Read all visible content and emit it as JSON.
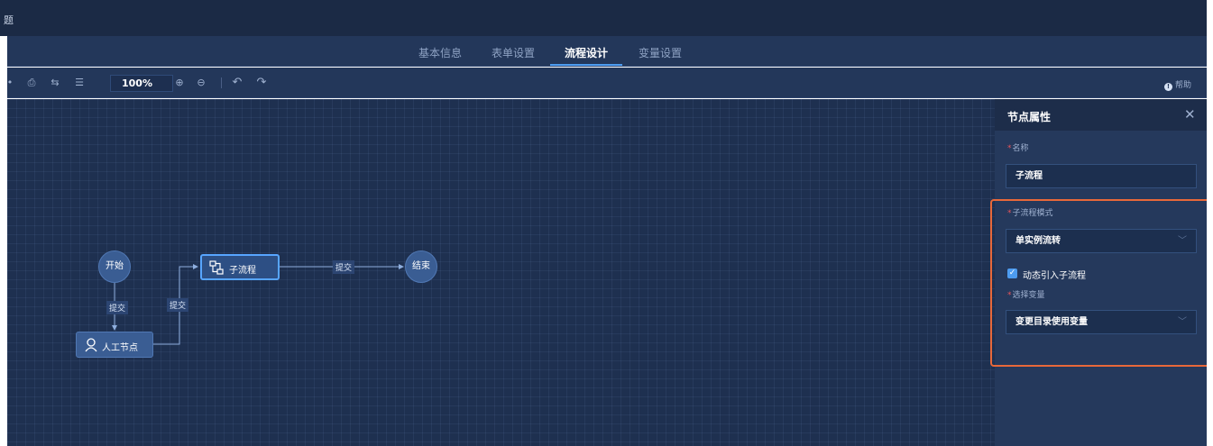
{
  "window": {
    "title_fragment": "题"
  },
  "tabs": [
    {
      "label": "基本信息",
      "active": false
    },
    {
      "label": "表单设置",
      "active": false
    },
    {
      "label": "流程设计",
      "active": true
    },
    {
      "label": "变量设置",
      "active": false
    }
  ],
  "toolbar": {
    "icons": [
      "save-icon",
      "print-icon",
      "code-icon",
      "layout-icon"
    ],
    "zoom": "100%",
    "zoom_in": "zoom-in-icon",
    "zoom_out": "zoom-out-icon",
    "undo": "undo-icon",
    "redo": "redo-icon",
    "help_label": "帮助"
  },
  "flow": {
    "nodes": {
      "start": "开始",
      "manual": "人工节点",
      "subprocess": "子流程",
      "end": "结束"
    },
    "edges": {
      "start_to_manual": "提交",
      "manual_to_sub": "提交",
      "sub_to_end": "提交"
    }
  },
  "panel": {
    "title": "节点属性",
    "close_icon": "close-icon",
    "name_label": "名称",
    "name_value": "子流程",
    "mode_label": "子流程模式",
    "mode_value": "单实例流转",
    "dynamic_checked": true,
    "dynamic_label": "动态引入子流程",
    "var_label": "选择变量",
    "var_value": "变更目录使用变量"
  },
  "colors": {
    "accent": "#4d9cf0",
    "highlight_frame": "#e8683a",
    "required": "#e8545a",
    "canvas_bg": "#1e3050"
  }
}
